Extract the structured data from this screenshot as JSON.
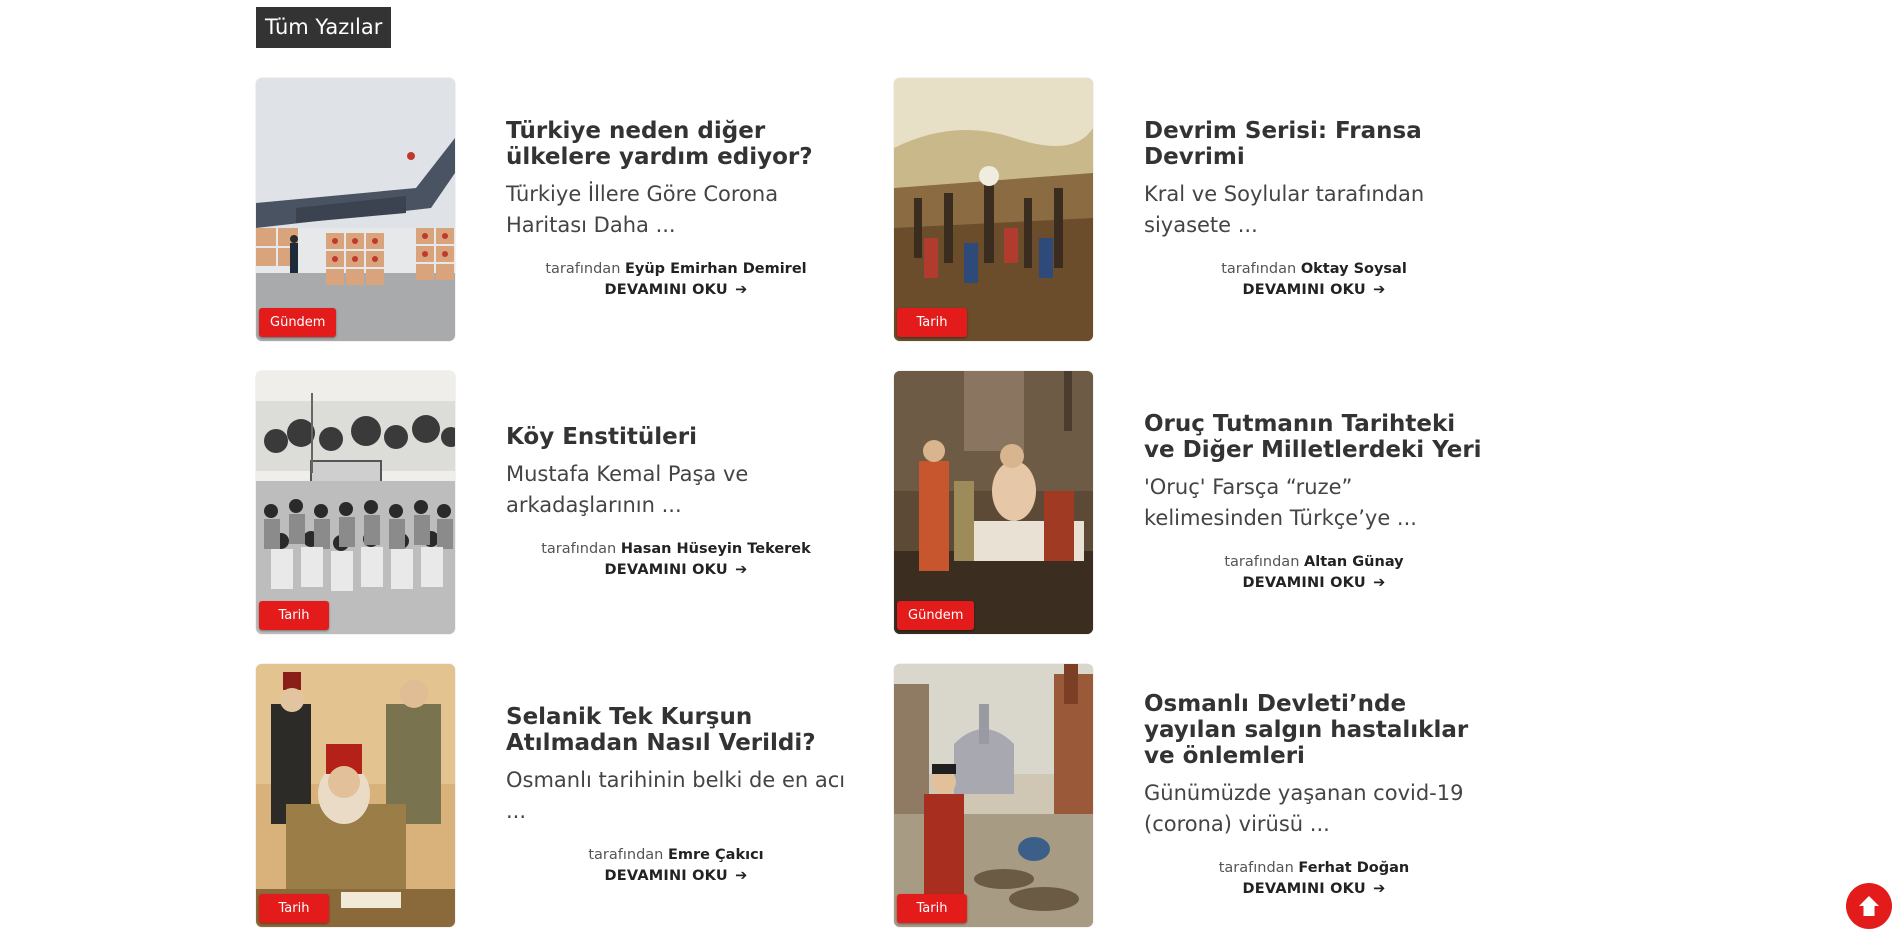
{
  "section": {
    "title": "Tüm Yazılar"
  },
  "posts": [
    {
      "title": "Türkiye neden diğer ülkelere yardım ediyor?",
      "excerpt": "Türkiye İllere Göre Corona Haritası Daha ...",
      "by_label": "tarafından",
      "author": "Eyüp Emirhan Demirel",
      "read_more": "DEVAMINI OKU",
      "category": "Gündem",
      "image": "cargo-plane-aid"
    },
    {
      "title": "Devrim Serisi: Fransa Devrimi",
      "excerpt": "Kral ve Soylular tarafından siyasete ...",
      "by_label": "tarafından",
      "author": "Oktay Soysal",
      "read_more": "DEVAMINI OKU",
      "category": "Tarih",
      "image": "revolution-painting"
    },
    {
      "title": "Köy Enstitüleri",
      "excerpt": "Mustafa Kemal Paşa ve arkadaşlarının ...",
      "by_label": "tarafından",
      "author": "Hasan Hüseyin Tekerek",
      "read_more": "DEVAMINI OKU",
      "category": "Tarih",
      "image": "old-photo-crowd"
    },
    {
      "title": "Oruç Tutmanın Tarihteki ve Diğer Milletlerdeki Yeri",
      "excerpt": "'Oruç' Farsça “ruze” kelimesinden Türkçe’ye ...",
      "by_label": "tarafından",
      "author": "Altan Günay",
      "read_more": "DEVAMINI OKU",
      "category": "Gündem",
      "image": "death-of-socrates-painting"
    },
    {
      "title": "Selanik Tek Kurşun Atılmadan Nasıl Verildi?",
      "excerpt": "Osmanlı tarihinin belki de en acı ...",
      "by_label": "tarafından",
      "author": "Emre Çakıcı",
      "read_more": "DEVAMINI OKU",
      "category": "Tarih",
      "image": "ottoman-officers-illustration"
    },
    {
      "title": "Osmanlı Devleti’nde yayılan salgın hastalıklar ve önlemleri",
      "excerpt": "Günümüzde yaşanan covid-19 (corona) virüsü ...",
      "by_label": "tarafından",
      "author": "Ferhat Doğan",
      "read_more": "DEVAMINI OKU",
      "category": "Tarih",
      "image": "plague-street-painting"
    }
  ],
  "icons": {
    "read_more": "arrow-right-icon",
    "scroll_top": "arrow-up-circle-icon"
  },
  "colors": {
    "accent": "#e31b1b",
    "title_bg": "#333333",
    "text": "#333333"
  }
}
